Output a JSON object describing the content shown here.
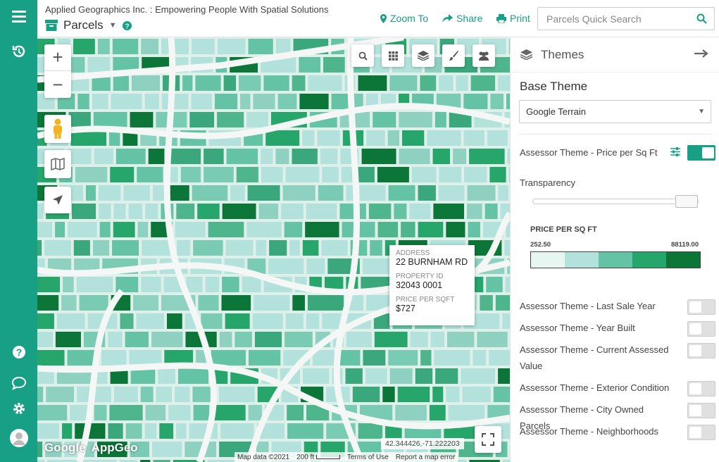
{
  "header": {
    "brand": "Applied Geographics Inc. : Empowering People With Spatial Solutions",
    "title": "Parcels",
    "zoom_to": "Zoom To",
    "share": "Share",
    "print": "Print",
    "search_placeholder": "Parcels Quick Search"
  },
  "map": {
    "popup": {
      "address_label": "ADDRESS",
      "address": "22 BURNHAM RD",
      "property_id_label": "PROPERTY ID",
      "property_id": "32043 0001",
      "price_label": "PRICE PER SQFT",
      "price": "$727"
    },
    "coordinates": "42.344426,-71.222203",
    "attribution": {
      "map_data": "Map data ©2021",
      "scale": "200 ft",
      "terms": "Terms of Use",
      "report": "Report a map error"
    },
    "logos": [
      "Google",
      "AppGeo"
    ]
  },
  "panel": {
    "title": "Themes",
    "base_theme_label": "Base Theme",
    "base_theme_value": "Google Terrain",
    "active_theme": "Assessor Theme - Price per Sq Ft",
    "transparency_label": "Transparency",
    "transparency": 0.95,
    "legend": {
      "title": "PRICE PER SQ FT",
      "min": "252.50",
      "max": "88119.00",
      "colors": [
        "#e8f6f2",
        "#b3e2dc",
        "#64c3a5",
        "#26a66a",
        "#0b7638"
      ]
    },
    "themes": [
      {
        "label": "Assessor Theme - Last Sale Year",
        "on": false
      },
      {
        "label": "Assessor Theme - Year Built",
        "on": false
      },
      {
        "label": "Assessor Theme - Current Assessed Value",
        "on": false
      },
      {
        "label": "Assessor Theme - Exterior Condition",
        "on": false
      },
      {
        "label": "Assessor Theme - City Owned Parcels",
        "on": false
      },
      {
        "label": "Assessor Theme - Neighborhoods",
        "on": false
      }
    ]
  },
  "colors": {
    "accent": "#17a086"
  }
}
